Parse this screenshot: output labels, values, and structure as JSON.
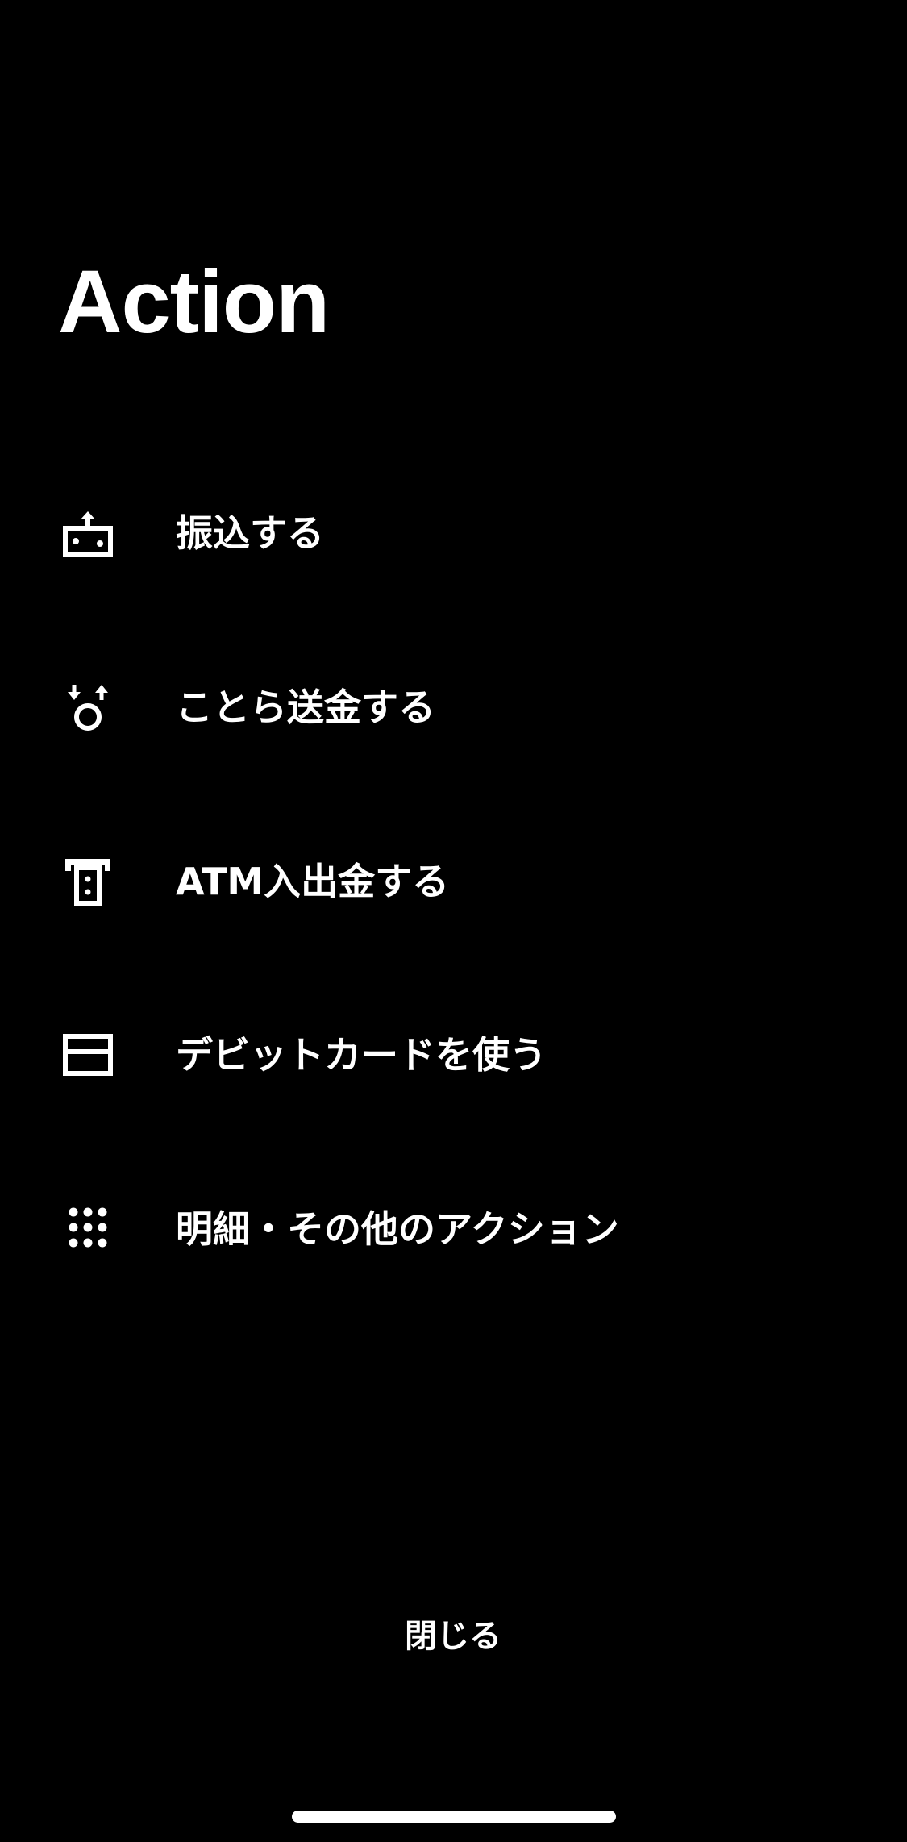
{
  "header": {
    "title": "Action"
  },
  "menu": {
    "items": [
      {
        "label": "振込する",
        "icon": "transfer-icon"
      },
      {
        "label": "ことら送金する",
        "icon": "cotra-transfer-icon"
      },
      {
        "label": "ATM入出金する",
        "icon": "atm-icon"
      },
      {
        "label": "デビットカードを使う",
        "icon": "debit-card-icon"
      },
      {
        "label": "明細・その他のアクション",
        "icon": "grid-dots-icon"
      }
    ]
  },
  "footer": {
    "close_label": "閉じる"
  },
  "colors": {
    "background": "#000000",
    "foreground": "#ffffff"
  }
}
